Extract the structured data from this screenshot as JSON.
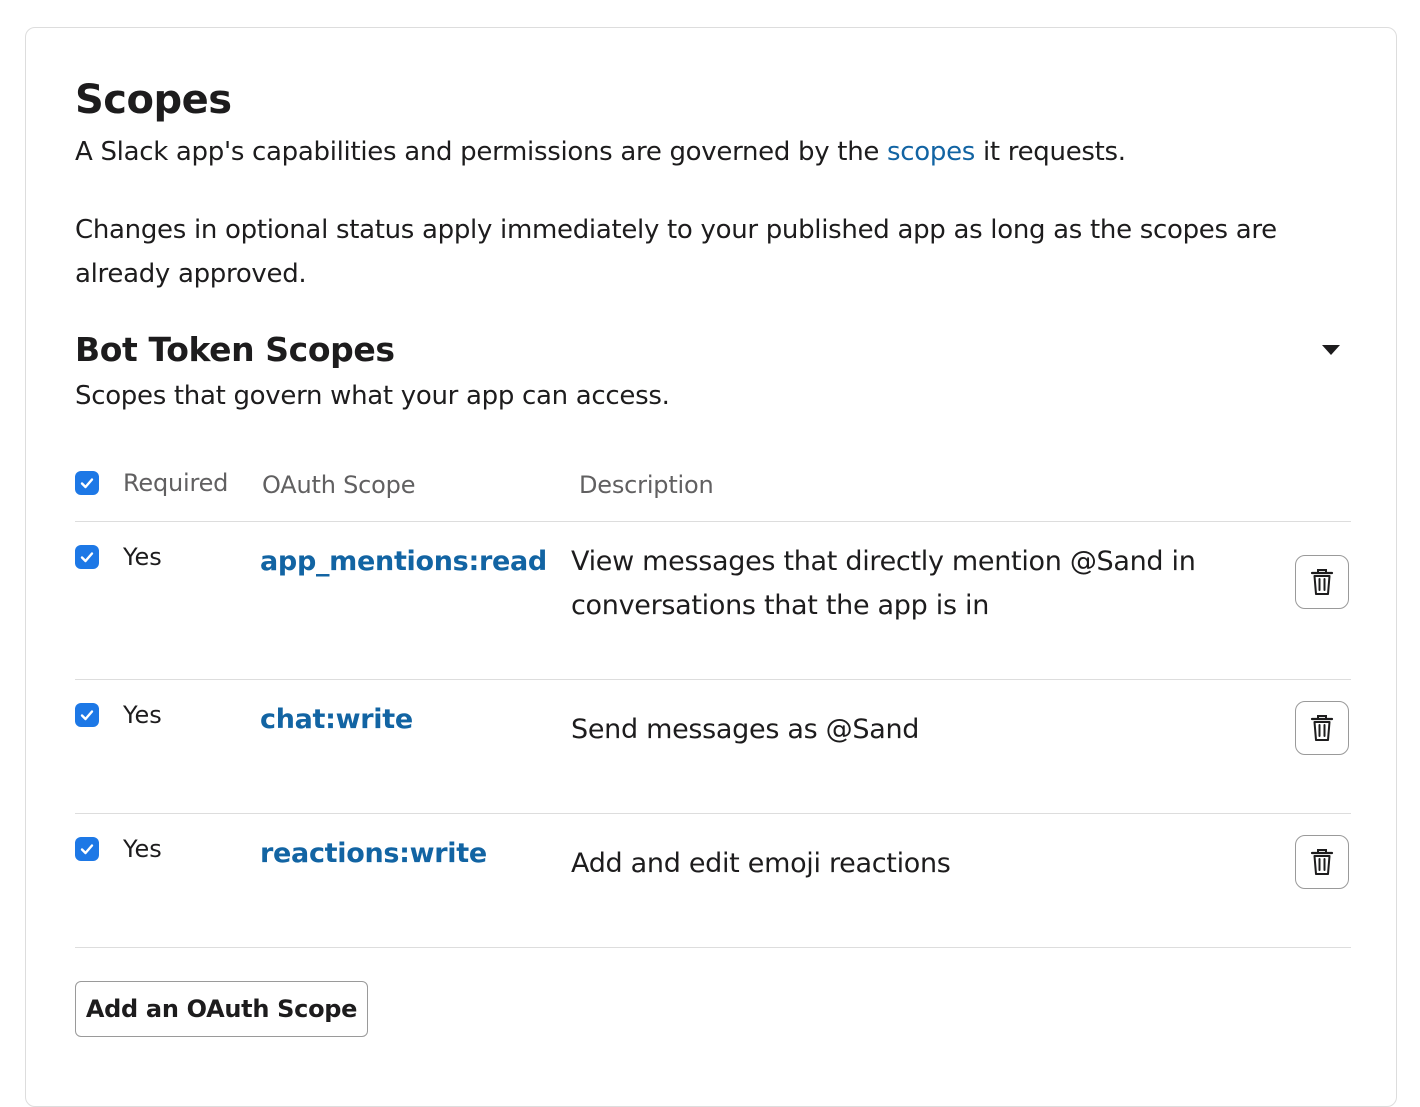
{
  "section": {
    "title": "Scopes",
    "intro_prefix": "A Slack app's capabilities and permissions are governed by the ",
    "intro_link": "scopes",
    "intro_suffix": " it requests.",
    "notice": "Changes in optional status apply immediately to your published app as long as the scopes are already approved."
  },
  "bot_scopes": {
    "title": "Bot Token Scopes",
    "subtitle": "Scopes that govern what your app can access.",
    "collapse_icon": "caret-down-icon",
    "columns": {
      "required": "Required",
      "scope": "OAuth Scope",
      "description": "Description"
    },
    "rows": [
      {
        "required": "Yes",
        "scope": "app_mentions:read",
        "description": "View messages that directly mention @Sand in conversations that the app is in"
      },
      {
        "required": "Yes",
        "scope": "chat:write",
        "description": "Send messages as @Sand"
      },
      {
        "required": "Yes",
        "scope": "reactions:write",
        "description": "Add and edit emoji reactions"
      }
    ],
    "add_button": "Add an OAuth Scope"
  },
  "colors": {
    "link": "#1264a3",
    "checkbox": "#1d78e6",
    "border": "#dddddd"
  }
}
